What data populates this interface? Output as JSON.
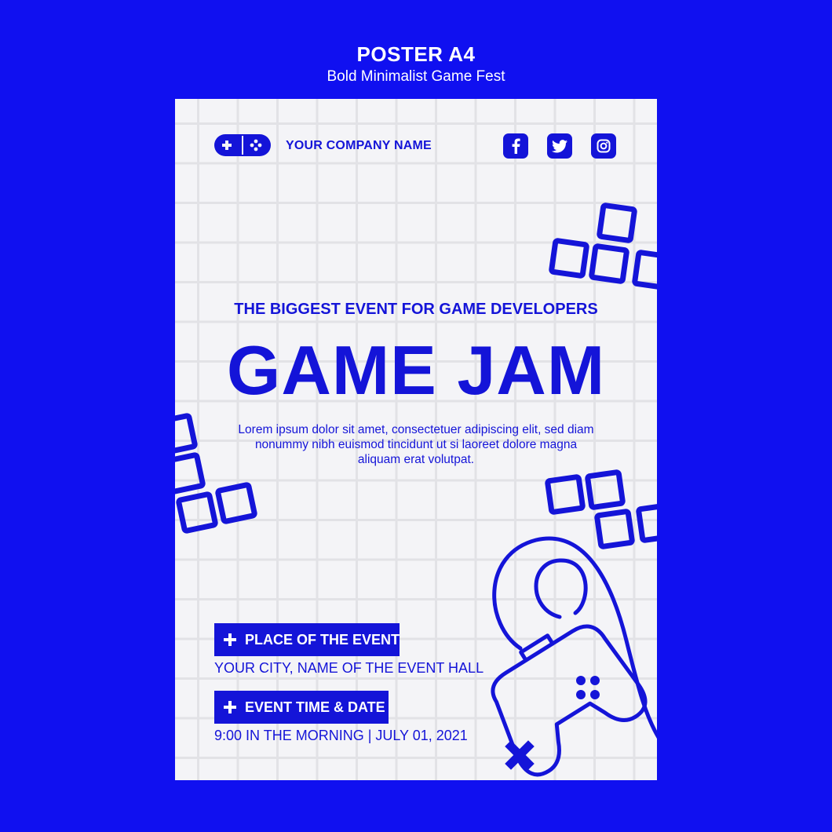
{
  "header": {
    "title": "POSTER A4",
    "subtitle": "Bold Minimalist Game Fest"
  },
  "poster": {
    "company_name": "YOUR COMPANY NAME",
    "social_icons": [
      "facebook-icon",
      "twitter-icon",
      "instagram-icon"
    ],
    "tagline": "THE BIGGEST EVENT FOR GAME DEVELOPERS",
    "headline": "GAME JAM",
    "body_text": "Lorem ipsum dolor sit amet, consectetuer adipiscing elit, sed diam nonummy nibh euismod tincidunt ut si laoreet dolore magna aliquam erat volutpat.",
    "place_label": "PLACE OF THE EVENT",
    "place_value": "YOUR CITY, NAME OF THE EVENT HALL",
    "time_label": "EVENT TIME & DATE",
    "time_value": "9:00 IN THE MORNING | JULY 01, 2021"
  },
  "colors": {
    "background": "#1010f0",
    "accent": "#1414d8",
    "paper": "#f4f4f7",
    "grid": "#e2e2e6"
  }
}
